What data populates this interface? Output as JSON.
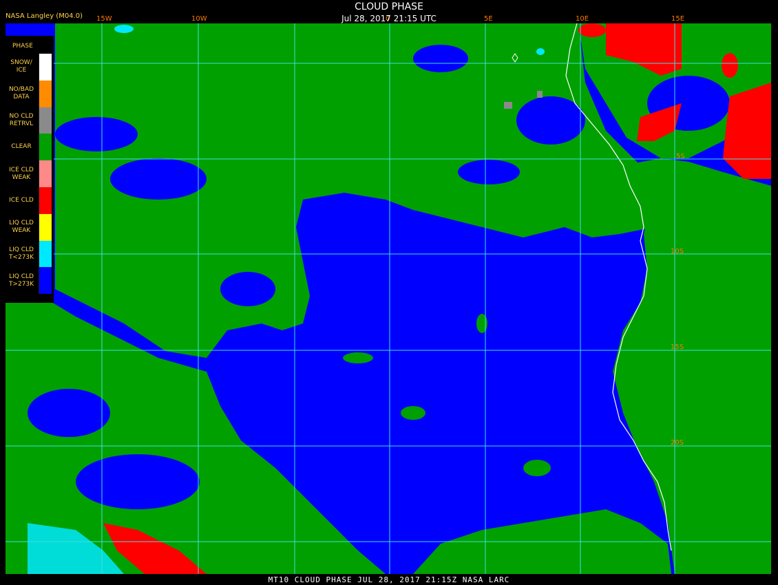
{
  "header": {
    "credit": "NASA Langley (M04.0)",
    "title": "CLOUD PHASE",
    "datetime": "Jul 28, 2017 21:15 UTC"
  },
  "footer": {
    "caption": "MT10  CLOUD PHASE   JUL 28, 2017 21:15Z   NASA LARC"
  },
  "legend": {
    "title": "PHASE",
    "items": [
      {
        "label": "SNOW/\nICE",
        "color": "#ffffff"
      },
      {
        "label": "NO/BAD\nDATA",
        "color": "#ff8c00"
      },
      {
        "label": "NO CLD\nRETRVL",
        "color": "#8a8a8a"
      },
      {
        "label": "CLEAR",
        "color": "#00a000"
      },
      {
        "label": "ICE CLD\nWEAK",
        "color": "#ff8888"
      },
      {
        "label": "ICE CLD",
        "color": "#ff0000"
      },
      {
        "label": "LIQ CLD\nWEAK",
        "color": "#ffff00"
      },
      {
        "label": "LIQ CLD\nT<273K",
        "color": "#00e8ff"
      },
      {
        "label": "LIQ CLD\nT>273K",
        "color": "#0000ff"
      }
    ]
  },
  "grid": {
    "longitude_labels": [
      "15W",
      "10W",
      "0",
      "5E",
      "10E",
      "15E"
    ],
    "latitude_labels": [
      "5S",
      "10S",
      "15S",
      "20S"
    ],
    "line_color": "#40e0e0"
  }
}
